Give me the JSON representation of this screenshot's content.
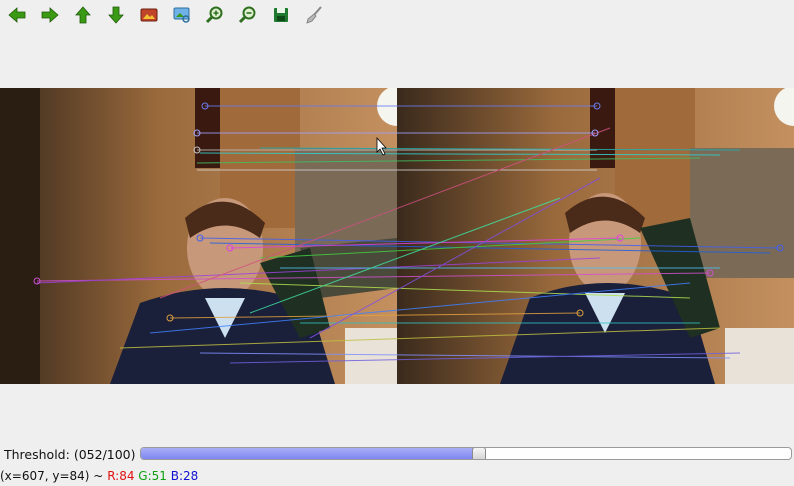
{
  "toolbar": {
    "buttons": [
      {
        "name": "arrow-left-icon",
        "color": "#3a9a14"
      },
      {
        "name": "arrow-right-icon",
        "color": "#3a9a14"
      },
      {
        "name": "arrow-up-icon",
        "color": "#3a9a14"
      },
      {
        "name": "arrow-down-icon",
        "color": "#3a9a14"
      },
      {
        "name": "image-icon",
        "color": "#8a3d2a"
      },
      {
        "name": "image-zoom-icon",
        "color": "#2d6f9e"
      },
      {
        "name": "zoom-in-icon",
        "color": "#2f6f1f"
      },
      {
        "name": "zoom-out-icon",
        "color": "#2f6f1f"
      },
      {
        "name": "save-icon",
        "color": "#1f7a30"
      },
      {
        "name": "brush-icon",
        "color": "#888888"
      }
    ]
  },
  "threshold": {
    "label": "Threshold:",
    "value_text": "(052/100)",
    "value": 52,
    "max": 100,
    "fill_color": "#7f86f0"
  },
  "status": {
    "coords": "(x=607, y=84) ~",
    "r": "R:84",
    "g": "G:51",
    "b": "B:28",
    "r_color": "#e01010",
    "g_color": "#10a010",
    "b_color": "#1010d0"
  }
}
